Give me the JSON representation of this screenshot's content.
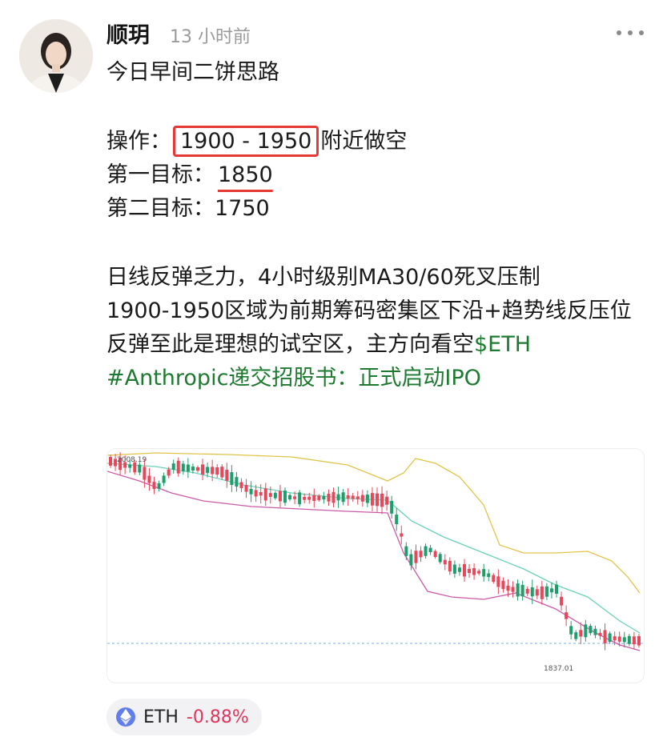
{
  "post": {
    "author": "顺玥",
    "time": "13 小时前",
    "title": "今日早间二饼思路",
    "op_label": "操作：",
    "op_range": "1900 - 1950",
    "op_suffix": "附近做空",
    "target1_label": "第一目标：",
    "target1_value": "1850",
    "target2_label": "第二目标：",
    "target2_value": "1750",
    "analysis_line1": "日线反弹乏力，4小时级别MA30/60死叉压制",
    "analysis_line2": "1900-1950区域为前期筹码密集区下沿+趋势线反压位",
    "analysis_line3_text": "反弹至此是理想的试空区，主方向看空",
    "analysis_line3_tag": "$ETH",
    "hashtag": "#Anthropic递交招股书：正式启动IPO"
  },
  "chart_data": {
    "type": "candlestick",
    "high_label": "2008.19",
    "low_label": "1837.01",
    "colors": {
      "up": "#1e9e6a",
      "down": "#e8475a",
      "upper_band": "#e0c44a",
      "lower_band": "#cc5aa8",
      "ma": "#6ad2b8",
      "dotted": "#7fb1e0"
    }
  },
  "token": {
    "icon": "ethereum-icon",
    "name": "ETH",
    "change": "-0.88%",
    "change_color": "#e0345a"
  }
}
